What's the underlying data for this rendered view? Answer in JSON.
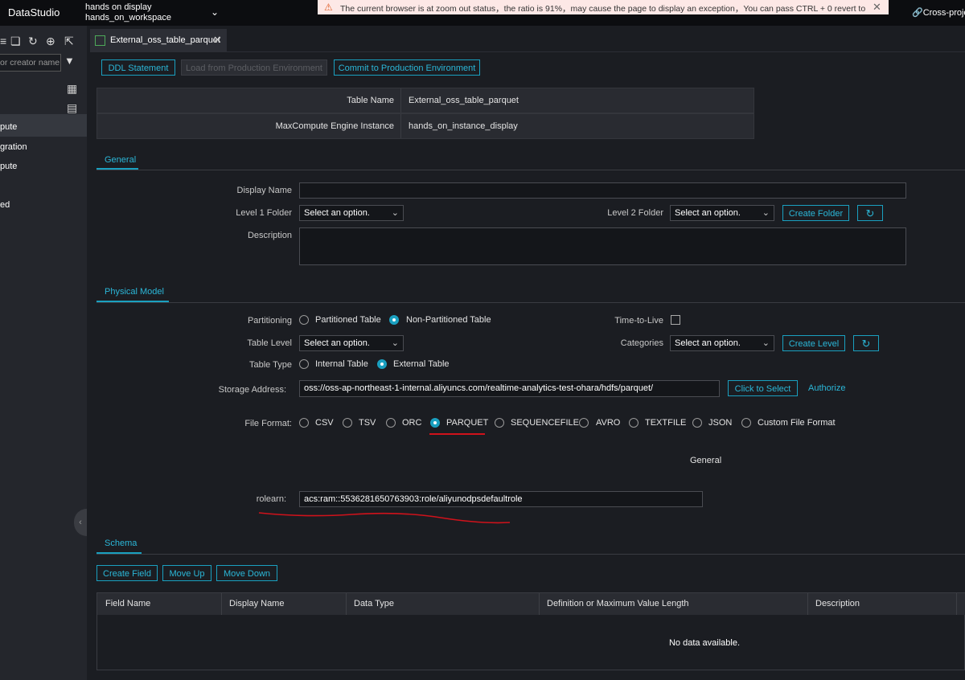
{
  "app": {
    "title": "DataStudio",
    "workspace_line1": "hands on display",
    "workspace_line2": "hands_on_workspace",
    "banner_text": "The current browser is at zoom out status，the ratio is 91%，may cause the page to display an exception，You can pass CTRL + 0 revert to",
    "cross_project_label": "Cross-proje"
  },
  "sidebar": {
    "search_placeholder": "or creator name",
    "items": [
      "pute",
      "gration",
      "pute",
      "ed"
    ]
  },
  "tab": {
    "label": "External_oss_table_parquet"
  },
  "toolbar": {
    "ddl_label": "DDL Statement",
    "load_label": "Load from Production Environment",
    "commit_label": "Commit to Production Environment"
  },
  "info": {
    "table_name_label": "Table Name",
    "table_name_value": "External_oss_table_parquet",
    "engine_label": "MaxCompute Engine Instance",
    "engine_value": "hands_on_instance_display"
  },
  "general": {
    "tab_label": "General",
    "display_name_label": "Display Name",
    "display_name_value": "",
    "level1_label": "Level 1 Folder",
    "level1_value": "Select an option.",
    "level2_label": "Level 2 Folder",
    "level2_value": "Select an option.",
    "create_folder_label": "Create Folder",
    "description_label": "Description",
    "description_value": ""
  },
  "physical": {
    "tab_label": "Physical Model",
    "partitioning_label": "Partitioning",
    "partitioned_label": "Partitioned Table",
    "non_partitioned_label": "Non-Partitioned Table",
    "ttl_label": "Time-to-Live",
    "table_level_label": "Table Level",
    "table_level_value": "Select an option.",
    "categories_label": "Categories",
    "categories_value": "Select an option.",
    "create_level_label": "Create Level",
    "table_type_label": "Table Type",
    "internal_label": "Internal Table",
    "external_label": "External Table",
    "storage_label": "Storage Address:",
    "storage_value": "oss://oss-ap-northeast-1-internal.aliyuncs.com/realtime-analytics-test-ohara/hdfs/parquet/",
    "click_select_label": "Click to Select",
    "authorize_label": "Authorize",
    "file_format_label": "File Format:",
    "formats": [
      "CSV",
      "TSV",
      "ORC",
      "PARQUET",
      "SEQUENCEFILE",
      "AVRO",
      "TEXTFILE",
      "JSON",
      "Custom File Format"
    ],
    "selected_format": "PARQUET",
    "general_sub_label": "General",
    "rolearn_label": "rolearn:",
    "rolearn_value": "acs:ram::5536281650763903:role/aliyunodpsdefaultrole"
  },
  "schema": {
    "tab_label": "Schema",
    "create_field_label": "Create Field",
    "move_up_label": "Move Up",
    "move_down_label": "Move Down",
    "columns": [
      "Field Name",
      "Display Name",
      "Data Type",
      "Definition or Maximum Value Length",
      "Description"
    ],
    "empty_text": "No data available."
  },
  "colors": {
    "accent": "#1aa0c0",
    "annotation": "#d0121b"
  }
}
